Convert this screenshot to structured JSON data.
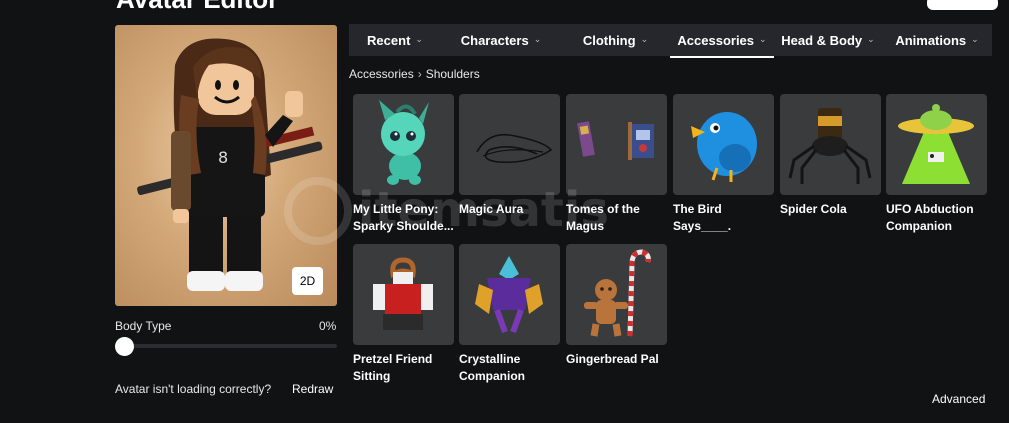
{
  "page": {
    "title": "Avatar Editor"
  },
  "preview": {
    "toggle_2d": "2D"
  },
  "body_type": {
    "label": "Body Type",
    "value": "0%",
    "level": 0
  },
  "loading": {
    "message": "Avatar isn't loading correctly?",
    "redraw": "Redraw"
  },
  "tabs": [
    {
      "label": "Recent",
      "active": false
    },
    {
      "label": "Characters",
      "active": false
    },
    {
      "label": "Clothing",
      "active": false
    },
    {
      "label": "Accessories",
      "active": true
    },
    {
      "label": "Head & Body",
      "active": false
    },
    {
      "label": "Animations",
      "active": false
    }
  ],
  "breadcrumb": {
    "parent": "Accessories",
    "current": "Shoulders"
  },
  "items": [
    {
      "name": "My Little Pony: Sparky Shoulde...",
      "icon": "green-pony-icon"
    },
    {
      "name": "Magic Aura",
      "icon": "aura-scribble-icon"
    },
    {
      "name": "Tomes of the Magus",
      "icon": "floating-books-icon"
    },
    {
      "name": "The Bird Says____.",
      "icon": "blue-bird-icon"
    },
    {
      "name": "Spider Cola",
      "icon": "spider-can-icon"
    },
    {
      "name": "UFO Abduction Companion",
      "icon": "ufo-icon"
    },
    {
      "name": "Pretzel Friend Sitting",
      "icon": "pretzel-figure-icon"
    },
    {
      "name": "Crystalline Companion",
      "icon": "crystal-creature-icon"
    },
    {
      "name": "Gingerbread Pal",
      "icon": "gingerbread-icon"
    }
  ],
  "footer": {
    "advanced": "Advanced"
  },
  "watermark": {
    "text": "itemsatis"
  },
  "colors": {
    "background": "#111214",
    "tabbar": "#25272c",
    "card": "#393b3d",
    "accent": "#ffffff"
  }
}
